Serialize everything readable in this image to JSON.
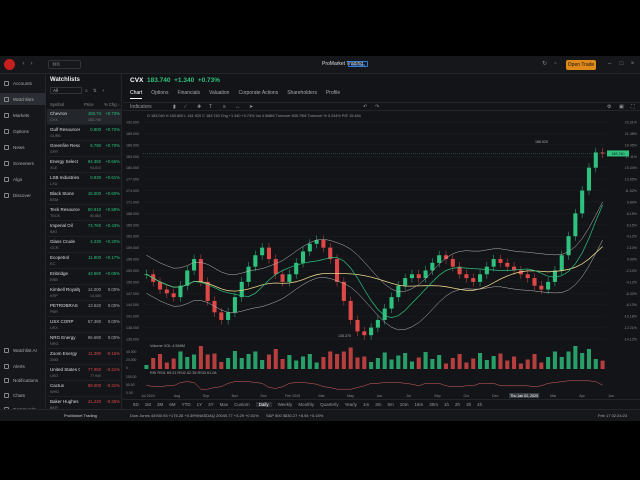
{
  "topbar": {
    "search_label": "⌘K",
    "brand": "ProMarket Trading",
    "brand_badge": "Markets",
    "trade_button": "Open Trade"
  },
  "nav": {
    "items": [
      {
        "label": "Accounts"
      },
      {
        "label": "Watchlists",
        "active": true
      },
      {
        "label": "Markets"
      },
      {
        "label": "Options"
      },
      {
        "label": "News"
      },
      {
        "label": "Screeners"
      },
      {
        "label": "Algo"
      },
      {
        "label": "Discover"
      }
    ],
    "bottom_items": [
      {
        "label": "Watchlist AI"
      },
      {
        "label": "Alerts"
      },
      {
        "label": "Notifications"
      },
      {
        "label": "Chats"
      },
      {
        "label": "Community"
      }
    ]
  },
  "watchlist": {
    "title": "Watchlists",
    "selector": "All",
    "tools": "≡ ⇅ +",
    "headers": {
      "symbol": "Symbol",
      "price": "Price",
      "change": "% Chg ↓"
    },
    "rows": [
      {
        "name": "Chevron",
        "sym": "CVX",
        "price": "183.74",
        "sub": "183.740",
        "chg": "+0.73%",
        "dir": "up",
        "selected": true
      },
      {
        "name": "Gulf Resources",
        "sym": "GURE",
        "price": "0.800",
        "sub": "",
        "chg": "+0.72%",
        "dir": "up"
      },
      {
        "name": "Greenfire Resources",
        "sym": "GFR",
        "price": "6.790",
        "sub": "",
        "chg": "+0.70%",
        "dir": "up"
      },
      {
        "name": "Energy Select",
        "sym": "XLE",
        "price": "94.350",
        "sub": "94.810",
        "chg": "+0.66%",
        "dir": "up"
      },
      {
        "name": "LSB Industries",
        "sym": "LXU",
        "price": "9.830",
        "sub": "",
        "chg": "+0.61%",
        "dir": "up"
      },
      {
        "name": "Black Stone",
        "sym": "BSM",
        "price": "15.000",
        "sub": "",
        "chg": "+0.60%",
        "dir": "up"
      },
      {
        "name": "Teck Resources",
        "sym": "TECK",
        "price": "50.910",
        "sub": "50.860",
        "chg": "+0.58%",
        "dir": "up"
      },
      {
        "name": "Imperial Oil",
        "sym": "IMO",
        "price": "74.760",
        "sub": "",
        "chg": "+0.43%",
        "dir": "up"
      },
      {
        "name": "Glass Crude",
        "sym": "GCR",
        "price": "4.230",
        "sub": "",
        "chg": "+0.20%",
        "dir": "up"
      },
      {
        "name": "Ecopetrol",
        "sym": "EC",
        "price": "11.900",
        "sub": "",
        "chg": "+0.17%",
        "dir": "up"
      },
      {
        "name": "Enbridge",
        "sym": "ENB",
        "price": "43.960",
        "sub": "",
        "chg": "+0.05%",
        "dir": "up"
      },
      {
        "name": "Kimbell Royalty",
        "sym": "KRP",
        "price": "14.000",
        "sub": "14.085",
        "chg": "0.00%",
        "dir": "nt"
      },
      {
        "name": "PETROBRAS",
        "sym": "PBR",
        "price": "13.620",
        "sub": "",
        "chg": "0.00%",
        "dir": "nt"
      },
      {
        "name": "USX CORP",
        "sym": "USX",
        "price": "57.380",
        "sub": "",
        "chg": "0.00%",
        "dir": "nt"
      },
      {
        "name": "NRG Energy",
        "sym": "NRG",
        "price": "96.680",
        "sub": "",
        "chg": "0.00%",
        "dir": "nt"
      },
      {
        "name": "Zoom Energy",
        "sym": "ZMD",
        "price": "11.390",
        "sub": "",
        "chg": "-0.16%",
        "dir": "dn"
      },
      {
        "name": "United States Oil",
        "sym": "USO",
        "price": "77.950",
        "sub": "77.940",
        "chg": "-0.21%",
        "dir": "dn"
      },
      {
        "name": "Cactus",
        "sym": "WHD",
        "price": "59.000",
        "sub": "",
        "chg": "-0.31%",
        "dir": "dn"
      },
      {
        "name": "Baker Hughes",
        "sym": "BKR",
        "price": "41.220",
        "sub": "",
        "chg": "-0.35%",
        "dir": "dn"
      }
    ]
  },
  "main": {
    "symbol": "CVX",
    "price": "183.740",
    "change": "+1.340",
    "change_pct": "+0.73%",
    "tabs": [
      "Chart",
      "Options",
      "Financials",
      "Valuation",
      "Corporate Actions",
      "Shareholders",
      "Profile"
    ],
    "active_tab": "Chart",
    "indicators_label": "Indicators",
    "ohlc_line": "O 183.040  H 183.800  L 181.920  C 183.740  Chg +1.340 +0.73%  Vol 4.568M  Turnover 835.79M  Turnover % 0.244%  P/E 15.484",
    "volume_label": "Volume  VOL 4.568M",
    "rsi_label": "RSI  RSI1 69.21  RSI2 62.35  RSI3 61.08",
    "crosshair_date": "Thu Jan 02, 2025",
    "price_tag": "183.740",
    "peak_label": "186.520",
    "trough_label": "135.370"
  },
  "chart_data": {
    "type": "candlestick",
    "price_axis": [
      "192.000",
      "189.000",
      "186.000",
      "183.000",
      "180.000",
      "177.000",
      "174.000",
      "171.000",
      "168.000",
      "165.000",
      "162.000",
      "159.000",
      "156.000",
      "153.000",
      "150.000",
      "147.000",
      "144.000",
      "141.000",
      "138.000",
      "135.000"
    ],
    "pct_axis": [
      "23.31%",
      "21.38%",
      "19.45%",
      "17.11%",
      "15.34%",
      "13.95%",
      "11.52%",
      "9.89%",
      "8.15%",
      "6.15%",
      "4.12%",
      "2.10%",
      "0.00%",
      "-2.10%",
      "-4.12%",
      "-6.32%",
      "-8.13%",
      "-10.18%",
      "-12.21%",
      "-14.12%"
    ],
    "x_labels": [
      "Jul 2024",
      "Aug",
      "Sep",
      "Nov",
      "Dec",
      "Feb 2025",
      "Mar",
      "May",
      "Jun",
      "Jul",
      "Sep",
      "Oct",
      "Dec",
      "Thu Jan 02, 2025",
      "Mar",
      "Apr",
      "Jun"
    ],
    "volume_axis": [
      "40,000",
      "20,000",
      "0"
    ],
    "rsi_axis": [
      "100.00",
      "50.00",
      "0.00"
    ],
    "close": [
      152,
      150,
      148,
      147,
      146,
      149,
      153,
      156,
      150,
      145,
      142,
      140,
      142,
      146,
      150,
      154,
      157,
      159,
      156,
      152,
      150,
      152,
      155,
      158,
      160,
      161,
      159,
      156,
      150,
      145,
      140,
      137,
      136,
      138,
      140,
      143,
      146,
      149,
      151,
      152,
      151,
      153,
      155,
      157,
      156,
      154,
      152,
      151,
      150,
      152,
      154,
      156,
      155,
      154,
      153,
      152,
      151,
      149,
      148,
      150,
      153,
      157,
      162,
      168,
      174,
      180,
      184,
      183.74
    ]
  },
  "bottombar": {
    "ranges": [
      "5D",
      "1M",
      "3M",
      "6M",
      "YTD",
      "1Y",
      "3Y",
      "Max",
      "Custom",
      "Daily",
      "Weekly",
      "Monthly",
      "Quarterly",
      "Yearly",
      "1m",
      "3m",
      "5m",
      "10m",
      "15m",
      "30m",
      "1h",
      "2h",
      "3h",
      "4h"
    ],
    "active_range": "Daily"
  },
  "statusbar": {
    "platform": "ProMarket Trading",
    "dow": "Dow Jones  44930.93  +175.28  +0.39%",
    "nasdaq": "NASDAQ  20040.77  +3.29  +0.01%",
    "sp500": "S&P 500  5830.27  +8.94  +0.15%",
    "clock": "Feb 17 02:24:23"
  }
}
